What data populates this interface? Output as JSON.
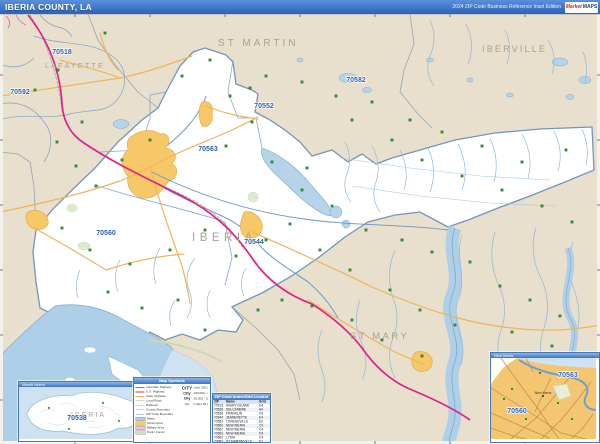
{
  "header": {
    "title": "IBERIA COUNTY, LA",
    "edition": "2024 ZIP Code Business Reference Inset Edition",
    "logo_market": "Market",
    "logo_maps": "MAPS"
  },
  "counties": {
    "lafayette": "LAFAYETTE",
    "st_martin": "ST MARTIN",
    "iberville": "IBERVILLE",
    "iberia": "IBERIA",
    "st_mary": "ST MARY"
  },
  "zips": {
    "z70518": "70518",
    "z70592": "70592",
    "z70552": "70552",
    "z70582": "70582",
    "z70563": "70563",
    "z70560": "70560",
    "z70544": "70544"
  },
  "marsh_inset": {
    "title": "Marsh Island",
    "county": "IBERIA",
    "zip": "70538"
  },
  "city_inset": {
    "title": "New Iberia",
    "city": "New Iberia",
    "zip_ne": "70563",
    "zip_sw": "70560"
  },
  "legend": {
    "title": "Map Symbols",
    "line_entries": [
      {
        "label": "Interstate Highway",
        "cls": "l-int"
      },
      {
        "label": "U.S. Highway",
        "cls": "l-us"
      },
      {
        "label": "State Highway",
        "cls": "l-state"
      },
      {
        "label": "Local Road",
        "cls": "l-local"
      },
      {
        "label": "Railroad",
        "cls": "l-rail"
      },
      {
        "label": "County Boundary",
        "cls": "l-county"
      },
      {
        "label": "ZIP Code Boundary",
        "cls": "l-zip"
      }
    ],
    "area_entries": [
      {
        "label": "Water",
        "cls": "a-water"
      },
      {
        "label": "Urban Area",
        "cls": "a-urban"
      },
      {
        "label": "Military Area",
        "cls": "a-mil"
      },
      {
        "label": "Park / Forest",
        "cls": "a-park"
      }
    ],
    "city_sizes": [
      {
        "sample": "CITY",
        "label": "Over 250,000"
      },
      {
        "sample": "City",
        "label": "100,000 - 250,000"
      },
      {
        "sample": "City",
        "label": "25,000 - 100,000"
      },
      {
        "sample": "city",
        "label": "Under 25,000"
      }
    ]
  },
  "zip_index": {
    "title": "ZIP Code Index/Grid Locator",
    "columns": [
      "ZIP",
      "Name",
      "Grid"
    ],
    "rows": [
      [
        "70513",
        "AVERY ISLAND",
        "D4"
      ],
      [
        "70528",
        "DELCAMBRE",
        "A4"
      ],
      [
        "70538",
        "FRANKLIN",
        "C6"
      ],
      [
        "70544",
        "JEANERETTE",
        "E4"
      ],
      [
        "70552",
        "LOREAUVILLE",
        "E2"
      ],
      [
        "70560",
        "NEW IBERIA",
        "C3"
      ],
      [
        "70562",
        "NEW IBERIA",
        "C4"
      ],
      [
        "70563",
        "NEW IBERIA",
        "D3"
      ],
      [
        "70569",
        "LYDIA",
        "C4"
      ],
      [
        "70582",
        "ST MARTINVILLE",
        "E1"
      ]
    ]
  },
  "colors": {
    "header_blue": "#2f6fc1",
    "county_tan": "#e8dfcc",
    "parish_white": "#ffffff",
    "water_fill": "#aecfe8",
    "water_line": "#7fa8cc",
    "zip_label_blue": "#2e5fa8",
    "county_label_gray": "#a8a195",
    "highway_pink": "#e0218a",
    "road_orange": "#efb55c",
    "urban_yellow": "#f6c868",
    "poi_green": "#2f8f2f"
  }
}
